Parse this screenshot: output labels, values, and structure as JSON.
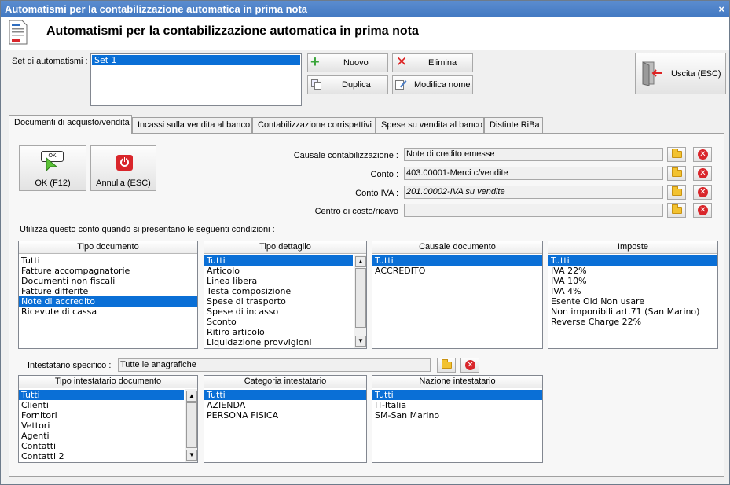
{
  "window": {
    "title": "Automatismi per la contabilizzazione automatica in prima nota",
    "close_label": "×"
  },
  "header": {
    "title": "Automatismi per la contabilizzazione automatica in prima nota"
  },
  "set": {
    "label": "Set di automatismi :",
    "items": [
      "Set 1"
    ]
  },
  "toolbar": {
    "nuovo": "Nuovo",
    "elimina": "Elimina",
    "duplica": "Duplica",
    "modifica_nome": "Modifica nome",
    "uscita": "Uscita (ESC)"
  },
  "tabs": [
    "Documenti di acquisto/vendita",
    "Incassi sulla vendita al banco",
    "Contabilizzazione corrispettivi",
    "Spese su vendita al banco",
    "Distinte RiBa"
  ],
  "actions": {
    "ok": "OK (F12)",
    "ok_icon_text": "OK",
    "annulla": "Annulla (ESC)"
  },
  "fields": {
    "causale_label": "Causale contabilizzazione :",
    "causale_value": "Note di credito emesse",
    "conto_label": "Conto :",
    "conto_value": "403.00001-Merci c/vendite",
    "contoiva_label": "Conto IVA :",
    "contoiva_value": "201.00002-IVA su vendite",
    "centro_label": "Centro di costo/ricavo",
    "centro_value": ""
  },
  "conditions_label": "Utilizza questo conto quando si presentano le seguenti condizioni :",
  "lists": {
    "tipo_documento": {
      "header": "Tipo documento",
      "items": [
        "Tutti",
        "Fatture accompagnatorie",
        "Documenti non fiscali",
        "Fatture differite",
        "Note di accredito",
        "Ricevute di cassa"
      ],
      "selected": 4
    },
    "tipo_dettaglio": {
      "header": "Tipo dettaglio",
      "items": [
        "Tutti",
        "Articolo",
        "Linea libera",
        "Testa composizione",
        "Spese di trasporto",
        "Spese di incasso",
        "Sconto",
        "Ritiro articolo",
        "Liquidazione provvigioni"
      ],
      "selected": 0
    },
    "causale_documento": {
      "header": "Causale documento",
      "items": [
        "Tutti",
        "ACCREDITO"
      ],
      "selected": 0
    },
    "imposte": {
      "header": "Imposte",
      "items": [
        "Tutti",
        "IVA 22%",
        "IVA 10%",
        "IVA 4%",
        "Esente Old Non usare",
        "Non imponibili art.71 (San Marino)",
        "Reverse Charge 22%"
      ],
      "selected": 0
    },
    "tipo_intestatario": {
      "header": "Tipo intestatario documento",
      "items": [
        "Tutti",
        "Clienti",
        "Fornitori",
        "Vettori",
        "Agenti",
        "Contatti",
        "Contatti 2"
      ],
      "selected": 0
    },
    "categoria_intestatario": {
      "header": "Categoria intestatario",
      "items": [
        "Tutti",
        "AZIENDA",
        "PERSONA FISICA"
      ],
      "selected": 0
    },
    "nazione_intestatario": {
      "header": "Nazione intestatario",
      "items": [
        "Tutti",
        "IT-Italia",
        "SM-San Marino"
      ],
      "selected": 0
    }
  },
  "intestatario": {
    "label": "Intestatario specifico :",
    "value": "Tutte le anagrafiche"
  },
  "colors": {
    "titlebar": "#4a82c9",
    "selection": "#0a6fd6"
  }
}
